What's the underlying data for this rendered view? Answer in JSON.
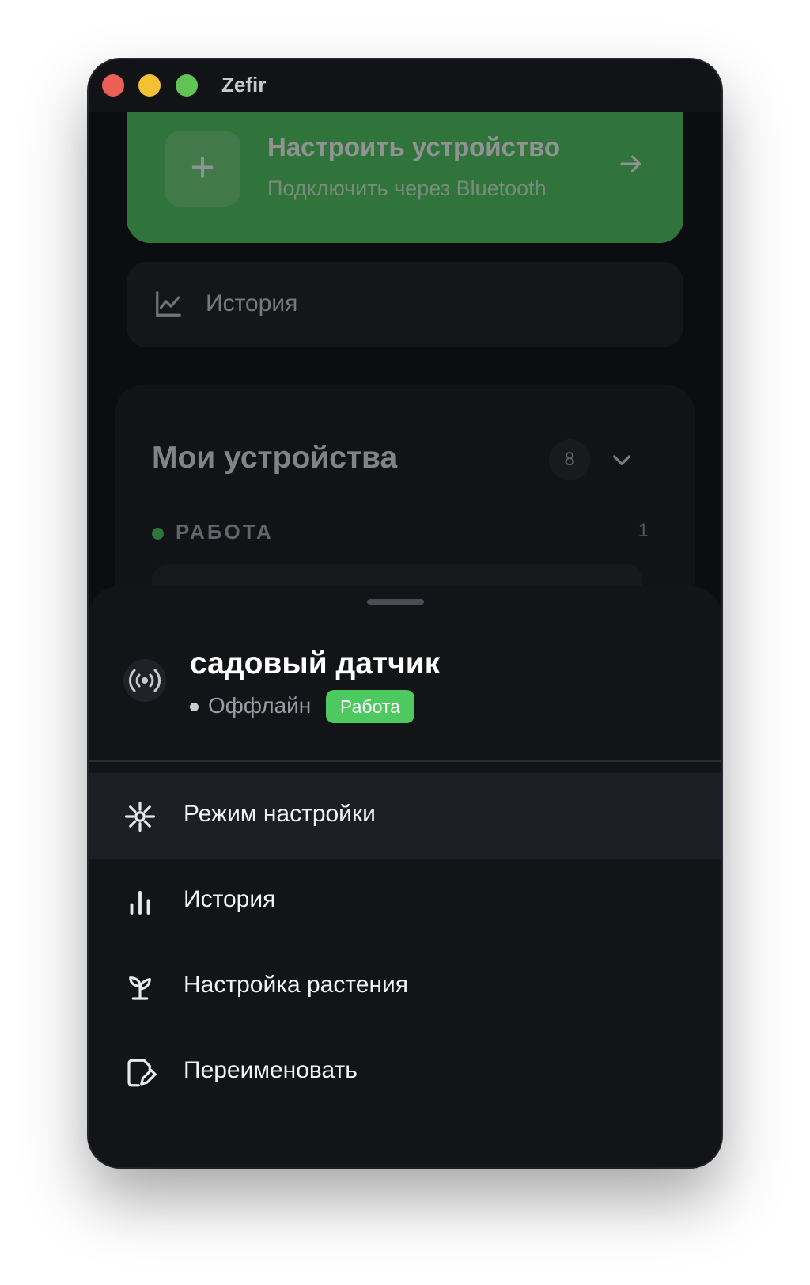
{
  "window": {
    "title": "Zefir"
  },
  "setup_card": {
    "title": "Настроить устройство",
    "subtitle": "Подключить через Bluetooth",
    "plus": "+"
  },
  "history_card": {
    "label": "История"
  },
  "devices": {
    "title": "Мои устройства",
    "count": "8",
    "group": {
      "label": "РАБОТА",
      "count": "1"
    }
  },
  "sheet": {
    "device_name": "садовый датчик",
    "status": "Оффлайн",
    "group_badge": "Работа",
    "menu": [
      {
        "label": "Режим настройки",
        "icon": "setup-mode-icon",
        "active": true
      },
      {
        "label": "История",
        "icon": "bar-chart-icon",
        "active": false
      },
      {
        "label": "Настройка растения",
        "icon": "sprout-icon",
        "active": false
      },
      {
        "label": "Переименовать",
        "icon": "edit-icon",
        "active": false
      }
    ]
  },
  "colors": {
    "accent_green": "#4ec95f",
    "window_bg": "#0c0d10",
    "sheet_bg": "#121418"
  }
}
